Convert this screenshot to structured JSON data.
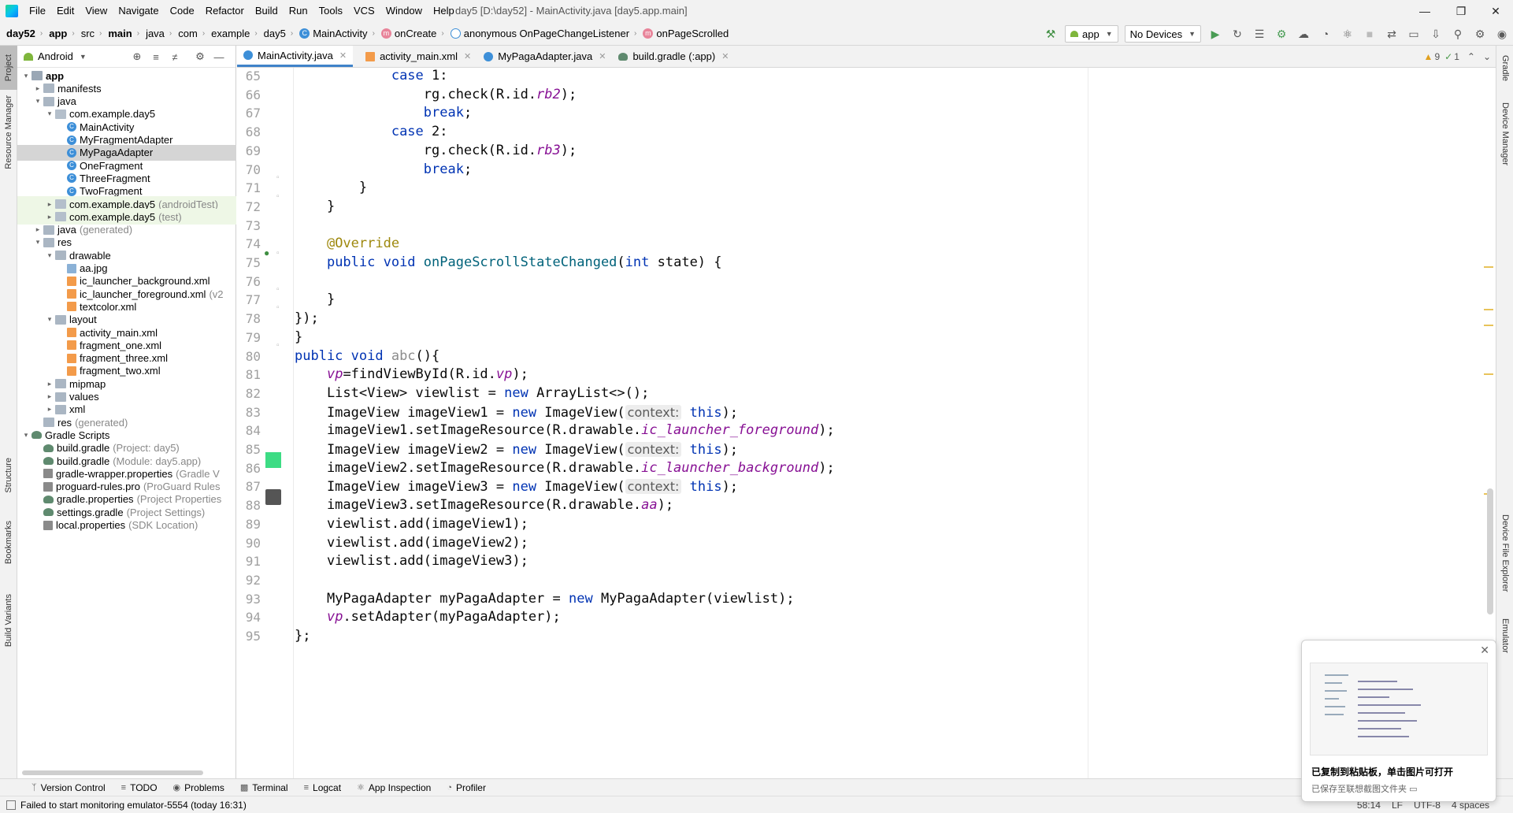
{
  "menubar": {
    "items": [
      "File",
      "Edit",
      "View",
      "Navigate",
      "Code",
      "Refactor",
      "Build",
      "Run",
      "Tools",
      "VCS",
      "Window",
      "Help"
    ],
    "title": "day5 [D:\\day52] - MainActivity.java [day5.app.main]"
  },
  "breadcrumb": [
    "day52",
    "app",
    "src",
    "main",
    "java",
    "com",
    "example",
    "day5",
    "MainActivity",
    "onCreate",
    "anonymous OnPageChangeListener",
    "onPageScrolled"
  ],
  "toolbar": {
    "run_config": "app",
    "device": "No Devices"
  },
  "left_tabs": [
    "Project",
    "Resource Manager",
    "Structure",
    "Bookmarks",
    "Build Variants"
  ],
  "right_tabs": [
    "Gradle",
    "Device Manager",
    "Device File Explorer",
    "Emulator"
  ],
  "project_panel": {
    "view_mode": "Android",
    "tree": [
      {
        "label": "app",
        "extra": "",
        "depth": 0,
        "icon": "folder-app",
        "expanded": true,
        "bold": true
      },
      {
        "label": "manifests",
        "extra": "",
        "depth": 1,
        "icon": "folder",
        "expanded": false
      },
      {
        "label": "java",
        "extra": "",
        "depth": 1,
        "icon": "folder",
        "expanded": true
      },
      {
        "label": "com.example.day5",
        "extra": "",
        "depth": 2,
        "icon": "pkg",
        "expanded": true
      },
      {
        "label": "MainActivity",
        "extra": "",
        "depth": 3,
        "icon": "cls"
      },
      {
        "label": "MyFragmentAdapter",
        "extra": "",
        "depth": 3,
        "icon": "cls"
      },
      {
        "label": "MyPagaAdapter",
        "extra": "",
        "depth": 3,
        "icon": "cls",
        "selected": true
      },
      {
        "label": "OneFragment",
        "extra": "",
        "depth": 3,
        "icon": "cls"
      },
      {
        "label": "ThreeFragment",
        "extra": "",
        "depth": 3,
        "icon": "cls"
      },
      {
        "label": "TwoFragment",
        "extra": "",
        "depth": 3,
        "icon": "cls"
      },
      {
        "label": "com.example.day5",
        "extra": "(androidTest)",
        "depth": 2,
        "icon": "pkg",
        "expanded": false,
        "test": true
      },
      {
        "label": "com.example.day5",
        "extra": "(test)",
        "depth": 2,
        "icon": "pkg",
        "expanded": false,
        "test": true
      },
      {
        "label": "java",
        "extra": "(generated)",
        "depth": 1,
        "icon": "folder",
        "expanded": false
      },
      {
        "label": "res",
        "extra": "",
        "depth": 1,
        "icon": "folder",
        "expanded": true
      },
      {
        "label": "drawable",
        "extra": "",
        "depth": 2,
        "icon": "folder",
        "expanded": true
      },
      {
        "label": "aa.jpg",
        "extra": "",
        "depth": 3,
        "icon": "img"
      },
      {
        "label": "ic_launcher_background.xml",
        "extra": "",
        "depth": 3,
        "icon": "xml"
      },
      {
        "label": "ic_launcher_foreground.xml",
        "extra": "(v2",
        "depth": 3,
        "icon": "xml"
      },
      {
        "label": "textcolor.xml",
        "extra": "",
        "depth": 3,
        "icon": "xml"
      },
      {
        "label": "layout",
        "extra": "",
        "depth": 2,
        "icon": "folder",
        "expanded": true
      },
      {
        "label": "activity_main.xml",
        "extra": "",
        "depth": 3,
        "icon": "xml"
      },
      {
        "label": "fragment_one.xml",
        "extra": "",
        "depth": 3,
        "icon": "xml"
      },
      {
        "label": "fragment_three.xml",
        "extra": "",
        "depth": 3,
        "icon": "xml"
      },
      {
        "label": "fragment_two.xml",
        "extra": "",
        "depth": 3,
        "icon": "xml"
      },
      {
        "label": "mipmap",
        "extra": "",
        "depth": 2,
        "icon": "folder",
        "expanded": false
      },
      {
        "label": "values",
        "extra": "",
        "depth": 2,
        "icon": "folder",
        "expanded": false
      },
      {
        "label": "xml",
        "extra": "",
        "depth": 2,
        "icon": "folder",
        "expanded": false
      },
      {
        "label": "res",
        "extra": "(generated)",
        "depth": 1,
        "icon": "folder"
      },
      {
        "label": "Gradle Scripts",
        "extra": "",
        "depth": 0,
        "icon": "gradle",
        "expanded": true
      },
      {
        "label": "build.gradle",
        "extra": "(Project: day5)",
        "depth": 1,
        "icon": "gradle"
      },
      {
        "label": "build.gradle",
        "extra": "(Module: day5.app)",
        "depth": 1,
        "icon": "gradle"
      },
      {
        "label": "gradle-wrapper.properties",
        "extra": "(Gradle V",
        "depth": 1,
        "icon": "props"
      },
      {
        "label": "proguard-rules.pro",
        "extra": "(ProGuard Rules",
        "depth": 1,
        "icon": "props"
      },
      {
        "label": "gradle.properties",
        "extra": "(Project Properties",
        "depth": 1,
        "icon": "gradle"
      },
      {
        "label": "settings.gradle",
        "extra": "(Project Settings)",
        "depth": 1,
        "icon": "gradle"
      },
      {
        "label": "local.properties",
        "extra": "(SDK Location)",
        "depth": 1,
        "icon": "props"
      }
    ]
  },
  "editor_tabs": [
    {
      "label": "MainActivity.java",
      "icon": "c",
      "active": true
    },
    {
      "label": "activity_main.xml",
      "icon": "x",
      "active": false
    },
    {
      "label": "MyPagaAdapter.java",
      "icon": "c",
      "active": false
    },
    {
      "label": "build.gradle (:app)",
      "icon": "g",
      "active": false
    }
  ],
  "inspections": {
    "warnings": "9",
    "weak": "1"
  },
  "code": {
    "first_line": 65,
    "lines": [
      [
        {
          "t": "            "
        },
        {
          "t": "case ",
          "c": "kw"
        },
        {
          "t": "1:"
        }
      ],
      [
        {
          "t": "                rg.check(R.id."
        },
        {
          "t": "rb2",
          "c": "fld"
        },
        {
          "t": ");"
        }
      ],
      [
        {
          "t": "                "
        },
        {
          "t": "break",
          "c": "kw"
        },
        {
          "t": ";"
        }
      ],
      [
        {
          "t": "            "
        },
        {
          "t": "case ",
          "c": "kw"
        },
        {
          "t": "2:"
        }
      ],
      [
        {
          "t": "                rg.check(R.id."
        },
        {
          "t": "rb3",
          "c": "fld"
        },
        {
          "t": ");"
        }
      ],
      [
        {
          "t": "                "
        },
        {
          "t": "break",
          "c": "kw"
        },
        {
          "t": ";"
        }
      ],
      [
        {
          "t": "        }"
        }
      ],
      [
        {
          "t": "    }"
        }
      ],
      [
        {
          "t": ""
        }
      ],
      [
        {
          "t": "    "
        },
        {
          "t": "@Override",
          "c": "ann"
        }
      ],
      [
        {
          "t": "    "
        },
        {
          "t": "public void ",
          "c": "kw"
        },
        {
          "t": "onPageScrollStateChanged",
          "c": "mth"
        },
        {
          "t": "("
        },
        {
          "t": "int ",
          "c": "kw"
        },
        {
          "t": "state) {"
        }
      ],
      [
        {
          "t": ""
        }
      ],
      [
        {
          "t": "    }"
        }
      ],
      [
        {
          "t": "});"
        }
      ],
      [
        {
          "t": "}"
        }
      ],
      [
        {
          "t": "public void ",
          "c": "kw"
        },
        {
          "t": "abc",
          "c": "muted-c"
        },
        {
          "t": "(){"
        }
      ],
      [
        {
          "t": "    "
        },
        {
          "t": "vp",
          "c": "fld"
        },
        {
          "t": "=findViewById(R.id."
        },
        {
          "t": "vp",
          "c": "fld"
        },
        {
          "t": ");"
        }
      ],
      [
        {
          "t": "    List<View> viewlist = "
        },
        {
          "t": "new ",
          "c": "kw"
        },
        {
          "t": "ArrayList<>();"
        }
      ],
      [
        {
          "t": "    ImageView imageView1 = "
        },
        {
          "t": "new ",
          "c": "kw"
        },
        {
          "t": "ImageView("
        },
        {
          "t": "context:",
          "c": "hint"
        },
        {
          "t": " "
        },
        {
          "t": "this",
          "c": "kw"
        },
        {
          "t": ");"
        }
      ],
      [
        {
          "t": "    imageView1.setImageResource(R.drawable."
        },
        {
          "t": "ic_launcher_foreground",
          "c": "fld"
        },
        {
          "t": ");"
        }
      ],
      [
        {
          "t": "    ImageView imageView2 = "
        },
        {
          "t": "new ",
          "c": "kw"
        },
        {
          "t": "ImageView("
        },
        {
          "t": "context:",
          "c": "hint"
        },
        {
          "t": " "
        },
        {
          "t": "this",
          "c": "kw"
        },
        {
          "t": ");"
        }
      ],
      [
        {
          "t": "    imageView2.setImageResource(R.drawable."
        },
        {
          "t": "ic_launcher_background",
          "c": "fld"
        },
        {
          "t": ");"
        }
      ],
      [
        {
          "t": "    ImageView imageView3 = "
        },
        {
          "t": "new ",
          "c": "kw"
        },
        {
          "t": "ImageView("
        },
        {
          "t": "context:",
          "c": "hint"
        },
        {
          "t": " "
        },
        {
          "t": "this",
          "c": "kw"
        },
        {
          "t": ");"
        }
      ],
      [
        {
          "t": "    imageView3.setImageResource(R.drawable."
        },
        {
          "t": "aa",
          "c": "fld"
        },
        {
          "t": ");"
        }
      ],
      [
        {
          "t": "    viewlist.add(imageView1);"
        }
      ],
      [
        {
          "t": "    viewlist.add(imageView2);"
        }
      ],
      [
        {
          "t": "    viewlist.add(imageView3);"
        }
      ],
      [
        {
          "t": ""
        }
      ],
      [
        {
          "t": "    MyPagaAdapter myPagaAdapter = "
        },
        {
          "t": "new ",
          "c": "kw"
        },
        {
          "t": "MyPagaAdapter(viewlist);"
        }
      ],
      [
        {
          "t": "    "
        },
        {
          "t": "vp",
          "c": "fld"
        },
        {
          "t": ".setAdapter(myPagaAdapter);"
        }
      ],
      [
        {
          "t": "};"
        }
      ]
    ]
  },
  "bottom_tabs": [
    "Version Control",
    "TODO",
    "Problems",
    "Terminal",
    "Logcat",
    "App Inspection",
    "Profiler"
  ],
  "status": {
    "message": "Failed to start monitoring emulator-5554 (today 16:31)",
    "position": "58:14",
    "line_sep": "LF",
    "encoding": "UTF-8",
    "indent": "4 spaces"
  },
  "notification": {
    "title": "已复制到粘贴板，单击图片可打开",
    "subtitle": "已保存至联想截图文件夹"
  },
  "colors": {
    "accent": "#4083c9",
    "keyword": "#0033b3",
    "field": "#871094",
    "annotation": "#9e880d",
    "method": "#00627a"
  }
}
